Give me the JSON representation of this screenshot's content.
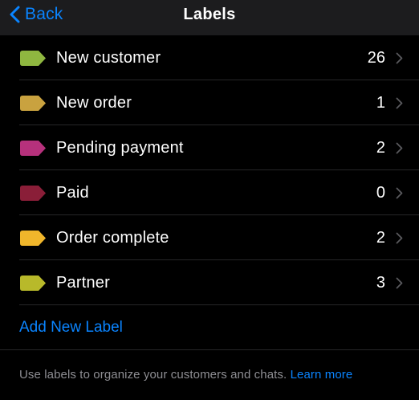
{
  "nav": {
    "back_label": "Back",
    "title": "Labels"
  },
  "labels": [
    {
      "name": "New customer",
      "count": "26",
      "color": "#8fb740"
    },
    {
      "name": "New order",
      "count": "1",
      "color": "#c9a23f"
    },
    {
      "name": "Pending payment",
      "count": "2",
      "color": "#b6317c"
    },
    {
      "name": "Paid",
      "count": "0",
      "color": "#8a1e38"
    },
    {
      "name": "Order complete",
      "count": "2",
      "color": "#f0b62b"
    },
    {
      "name": "Partner",
      "count": "3",
      "color": "#b8b92a"
    }
  ],
  "add_label": "Add New Label",
  "footer": {
    "text": "Use labels to organize your customers and chats.",
    "link": "Learn more"
  },
  "colors": {
    "accent": "#0a84ff",
    "background": "#000000",
    "nav_background": "#1c1c1e",
    "secondary_text": "#8e8e93"
  },
  "icons": {
    "back": "chevron-left-icon",
    "row_disclosure": "chevron-right-icon",
    "label_tag": "tag-icon"
  }
}
